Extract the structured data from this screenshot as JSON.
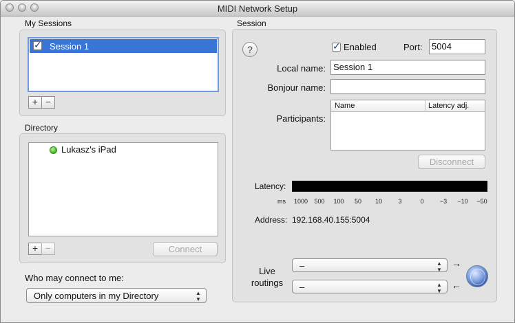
{
  "window": {
    "title": "MIDI Network Setup"
  },
  "my_sessions": {
    "label": "My Sessions",
    "items": [
      {
        "label": "Session 1",
        "checked": true,
        "selected": true
      }
    ],
    "add_label": "+",
    "remove_label": "−"
  },
  "directory": {
    "label": "Directory",
    "items": [
      {
        "label": "Lukasz's iPad",
        "status_color": "#4cbf2c"
      }
    ],
    "add_label": "+",
    "remove_label": "−",
    "connect_label": "Connect"
  },
  "who_may_connect": {
    "label": "Who may connect to me:",
    "selected": "Only computers in my Directory"
  },
  "session": {
    "label": "Session",
    "help_label": "?",
    "enabled_label": "Enabled",
    "enabled": true,
    "port_label": "Port:",
    "port_value": "5004",
    "local_name_label": "Local name:",
    "local_name_value": "Session 1",
    "bonjour_name_label": "Bonjour name:",
    "bonjour_name_value": "",
    "participants_label": "Participants:",
    "participants_columns": [
      "Name",
      "Latency adj."
    ],
    "disconnect_label": "Disconnect",
    "latency_label": "Latency:",
    "latency_ticks": [
      "ms",
      "1000",
      "500",
      "100",
      "50",
      "10",
      "3",
      "0",
      "−3",
      "−10",
      "−50"
    ],
    "address_label": "Address:",
    "address_value": "192.168.40.155:5004",
    "live_routings_label": "Live routings",
    "routing_in": "–",
    "routing_out": "–"
  },
  "colors": {
    "selection": "#3875d7",
    "meter": "#000000"
  }
}
